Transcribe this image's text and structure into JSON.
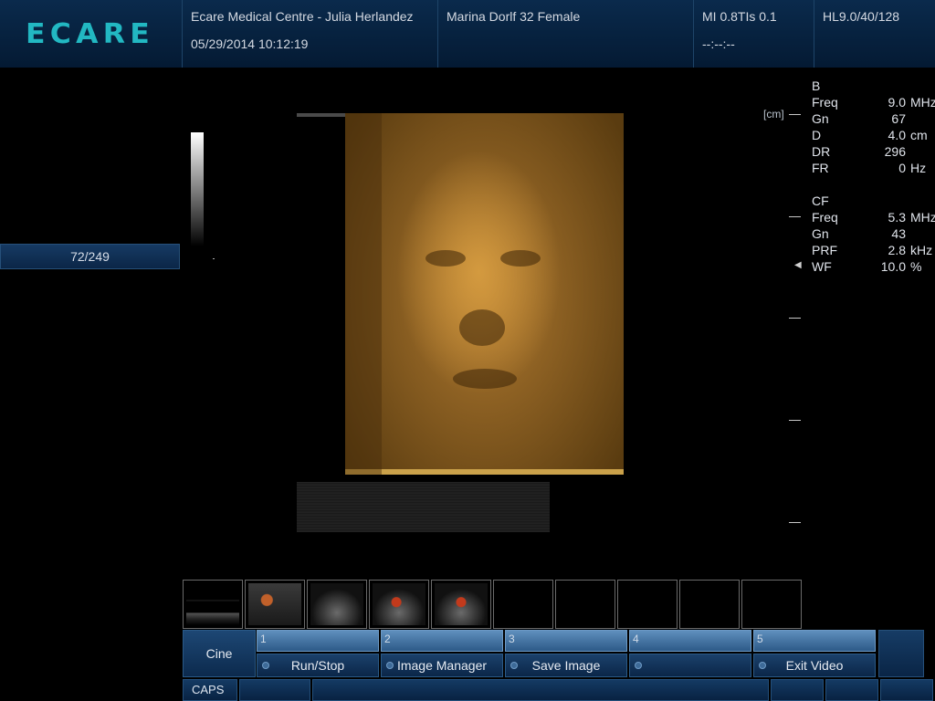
{
  "header": {
    "logo": "ECARE",
    "facility": "Ecare Medical Centre - Julia Herlandez",
    "datetime": "05/29/2014 10:12:19",
    "patient": "Marina Dorlf 32 Female",
    "mi_tis": "MI 0.8TIs 0.1",
    "timer": "--:--:--",
    "probe_info": "HL9.0/40/128"
  },
  "frame_counter": "72/249",
  "depth_unit": "[cm]",
  "b_mode": {
    "title": "B",
    "params": [
      {
        "key": "Freq",
        "value": "9.0",
        "unit": "MHz"
      },
      {
        "key": "Gn",
        "value": "67",
        "unit": ""
      },
      {
        "key": "D",
        "value": "4.0",
        "unit": "cm"
      },
      {
        "key": "DR",
        "value": "296",
        "unit": ""
      },
      {
        "key": "FR",
        "value": "0",
        "unit": "Hz"
      }
    ]
  },
  "cf_mode": {
    "title": "CF",
    "params": [
      {
        "key": "Freq",
        "value": "5.3",
        "unit": "MHz"
      },
      {
        "key": "Gn",
        "value": "43",
        "unit": ""
      },
      {
        "key": "PRF",
        "value": "2.8",
        "unit": "kHz"
      },
      {
        "key": "WF",
        "value": "10.0",
        "unit": "%"
      }
    ]
  },
  "softkeys": {
    "cine": "Cine",
    "keys": [
      {
        "num": "1",
        "label": "Run/Stop"
      },
      {
        "num": "2",
        "label": "Image Manager"
      },
      {
        "num": "3",
        "label": "Save Image"
      },
      {
        "num": "4",
        "label": ""
      },
      {
        "num": "5",
        "label": "Exit Video"
      }
    ]
  },
  "status_bar": {
    "caps": "CAPS"
  },
  "colors": {
    "logo": "#22b8c2",
    "header_bg": "#0a2a4c",
    "softkey_num_bg": "#5f8fbd",
    "softkey_label_bg": "#1b416b",
    "render_tint": "#b07a30"
  },
  "icons": {
    "wf_marker": "triangle-left-icon"
  }
}
